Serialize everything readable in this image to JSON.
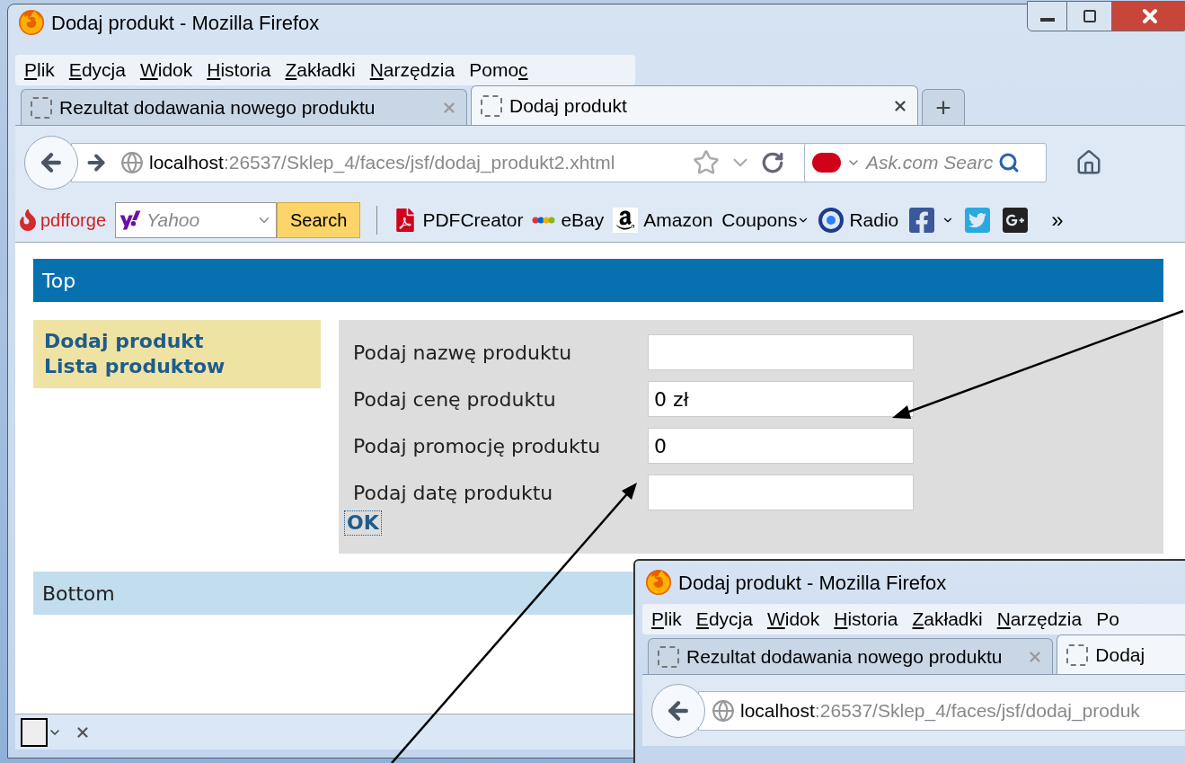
{
  "window": {
    "title": "Dodaj produkt - Mozilla Firefox"
  },
  "menu": [
    {
      "key": "P",
      "post": "lik"
    },
    {
      "key": "E",
      "post": "dycja"
    },
    {
      "key": "W",
      "post": "idok"
    },
    {
      "key": "H",
      "post": "istoria"
    },
    {
      "key": "Z",
      "post": "akładki"
    },
    {
      "key": "N",
      "post": "arzędzia"
    },
    {
      "pre": "Pomo",
      "key": "c"
    }
  ],
  "tabs": [
    {
      "label": "Rezultat dodawania nowego produktu",
      "selected": false
    },
    {
      "label": "Dodaj produkt",
      "selected": true
    }
  ],
  "new_tab": "+",
  "address": {
    "host": "localhost",
    "path": ":26537/Sklep_4/faces/jsf/dodaj_produkt2.xhtml"
  },
  "search": {
    "placeholder": "Ask.com Searc"
  },
  "bookmarks": {
    "brand": "pdfforge",
    "yahoo_placeholder": "Yahoo",
    "search_button": "Search",
    "items": [
      {
        "kind": "pdf",
        "label": "PDFCreator"
      },
      {
        "kind": "ebay",
        "label": "eBay"
      },
      {
        "kind": "amazon",
        "label": "Amazon"
      },
      {
        "kind": "menu",
        "label": "Coupons"
      },
      {
        "kind": "radio",
        "label": "Radio"
      },
      {
        "kind": "facebook"
      },
      {
        "kind": "twitter"
      },
      {
        "kind": "gplus"
      }
    ],
    "overflow": "»"
  },
  "page": {
    "top": "Top",
    "sidebar": [
      "Dodaj produkt",
      "Lista produktow"
    ],
    "fields": [
      {
        "label": "Podaj nazwę produktu"
      },
      {
        "label": "Podaj cenę produktu",
        "value": "0 zł"
      },
      {
        "label": "Podaj promocję produktu",
        "value": "0"
      },
      {
        "label": "Podaj datę produktu"
      }
    ],
    "submit": "OK",
    "bottom": "Bottom"
  },
  "second_window": {
    "title": "Dodaj produkt - Mozilla Firefox",
    "menu": [
      {
        "key": "P",
        "post": "lik"
      },
      {
        "key": "E",
        "post": "dycja"
      },
      {
        "key": "W",
        "post": "idok"
      },
      {
        "key": "H",
        "post": "istoria"
      },
      {
        "key": "Z",
        "post": "akładki"
      },
      {
        "key": "N",
        "post": "arzędzia"
      },
      {
        "pre": "Po"
      }
    ],
    "tabs": [
      {
        "label": "Rezultat dodawania nowego produktu",
        "selected": false
      },
      {
        "label": "Dodaj",
        "selected": true
      }
    ],
    "address": {
      "host": "localhost",
      "path": ":26537/Sklep_4/faces/jsf/dodaj_produk"
    }
  }
}
